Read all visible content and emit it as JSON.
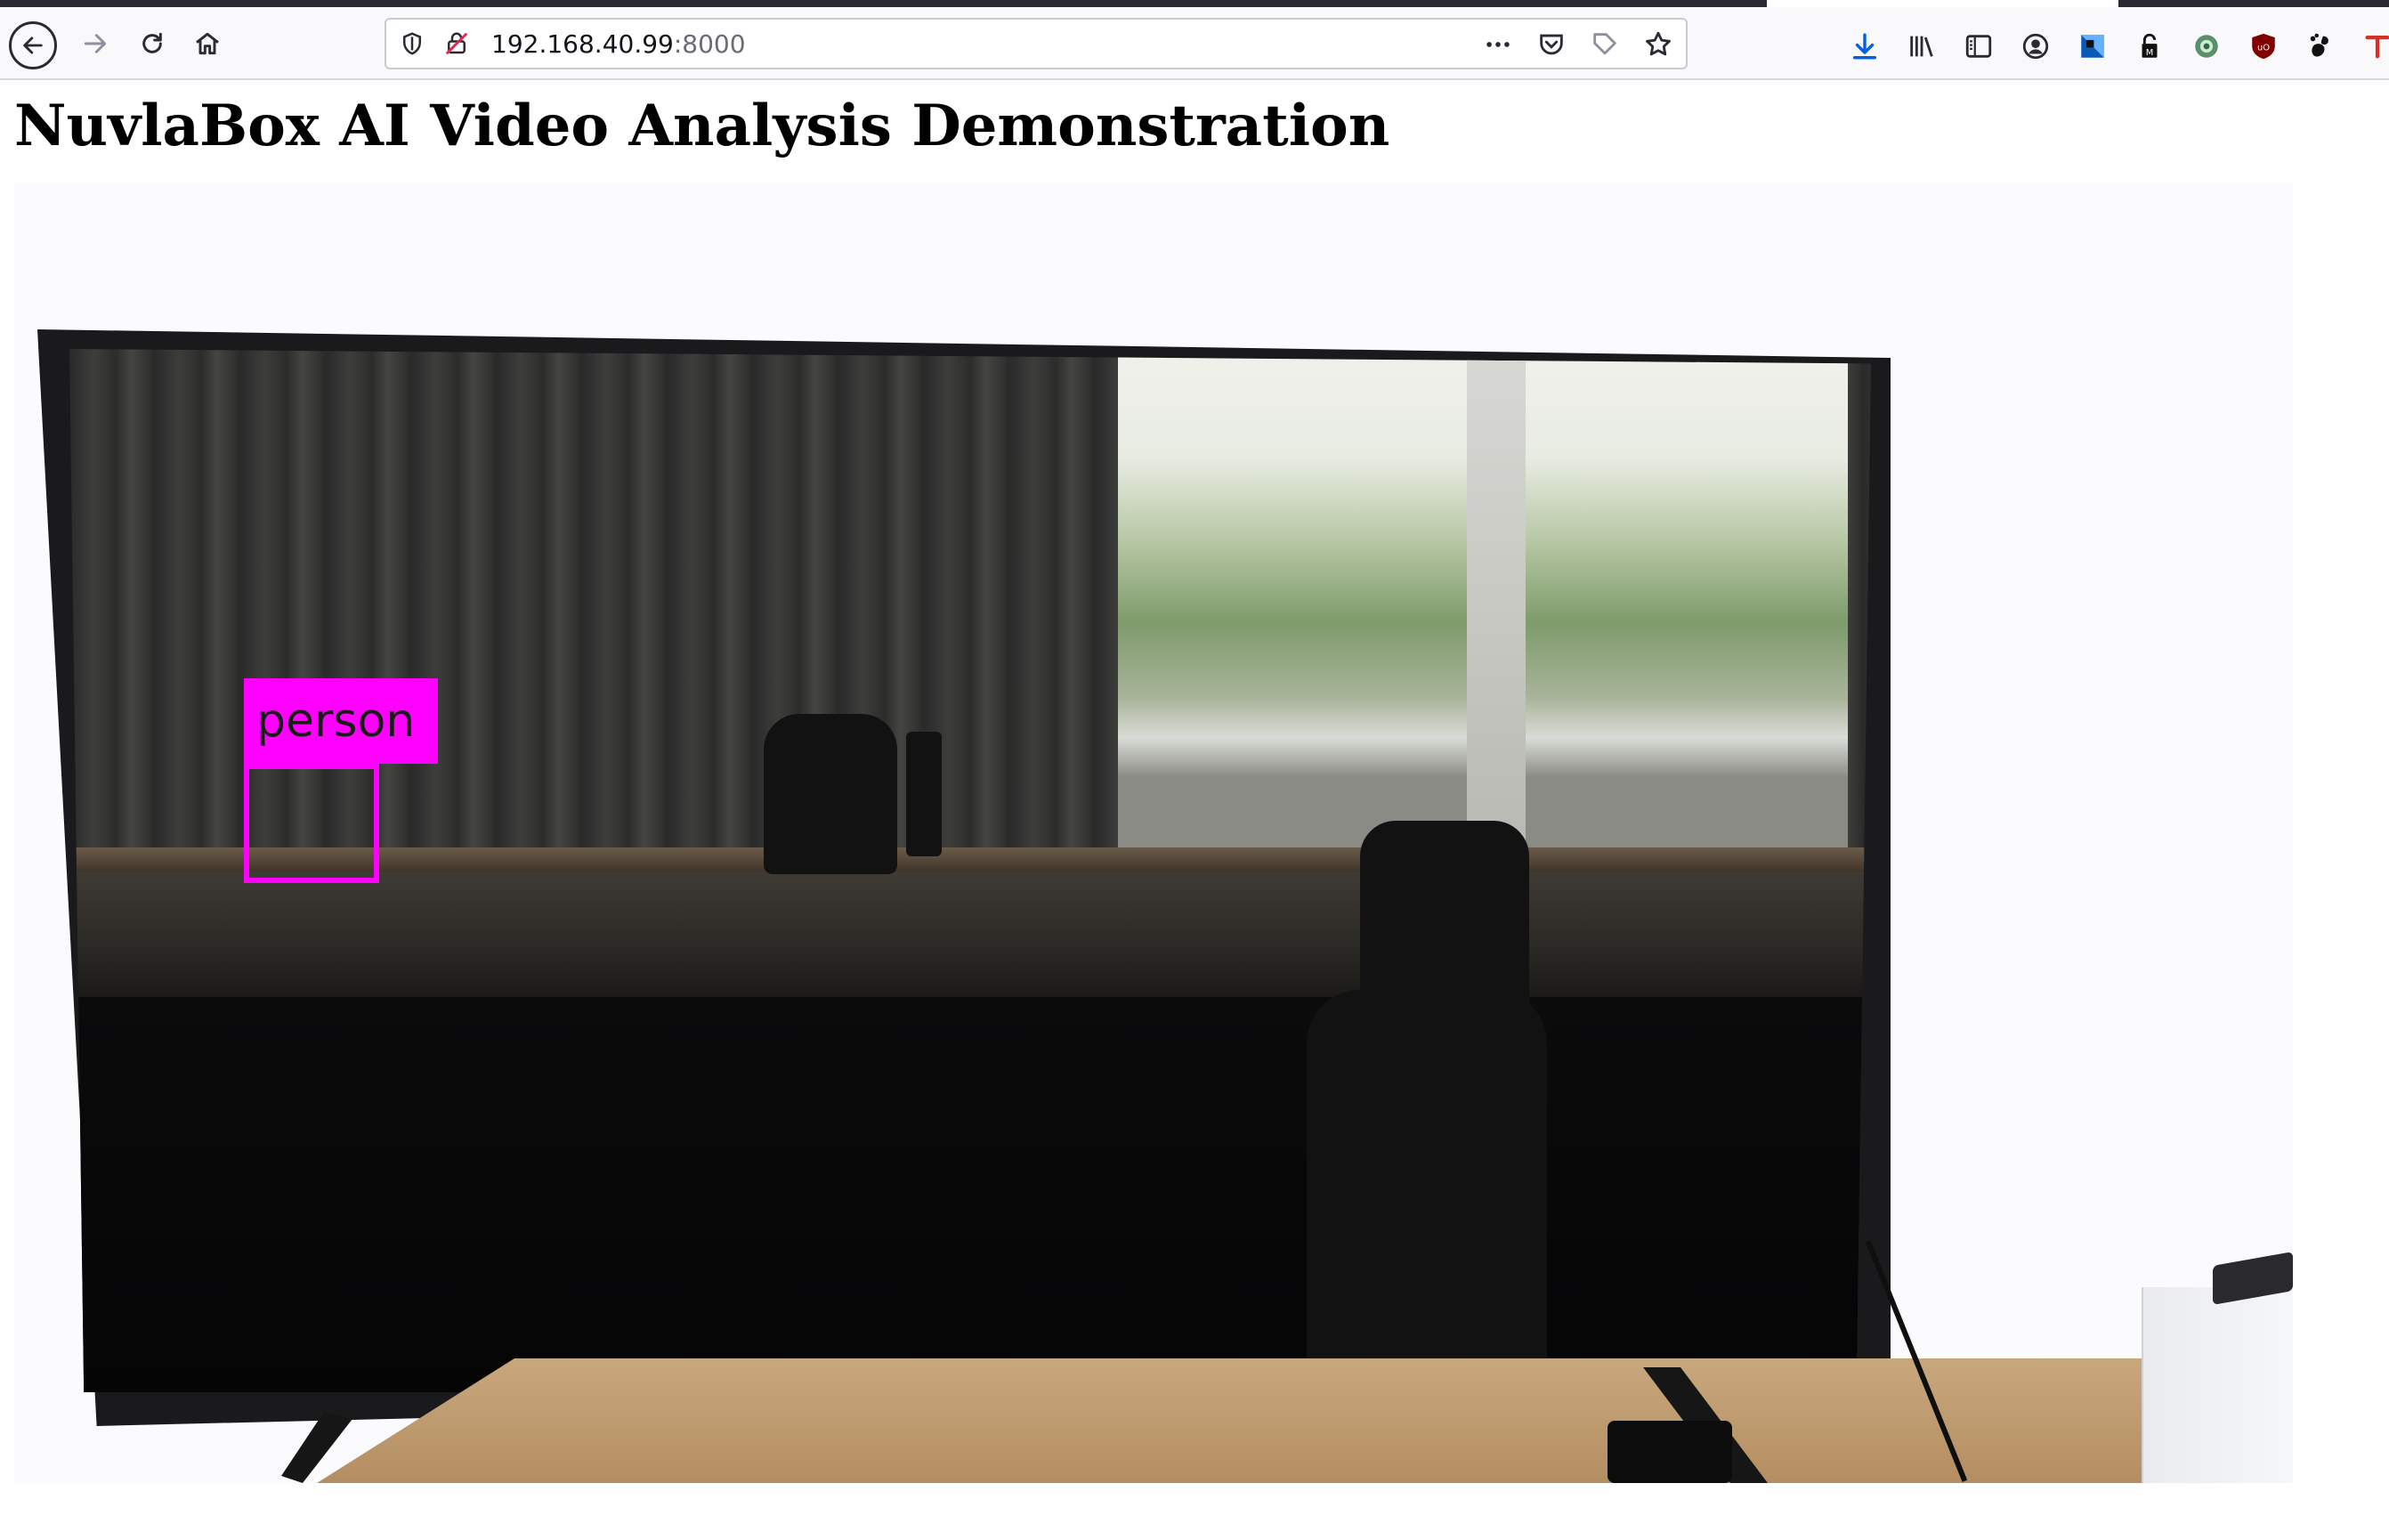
{
  "browser": {
    "url_host": "192.168.40.99",
    "url_port": ":8000",
    "colors": {
      "toolbar_bg": "#f9f9fb",
      "download_accent": "#0060df",
      "ublock_red": "#800000"
    },
    "nav_icons": [
      "back-arrow-icon",
      "forward-arrow-icon",
      "reload-icon",
      "home-icon"
    ],
    "url_icons": [
      "tracking-shield-icon",
      "insecure-lock-icon"
    ],
    "url_action_icons": [
      "more-actions-icon",
      "pocket-icon",
      "pin-tab-icon",
      "bookmark-star-icon"
    ],
    "extension_icons": [
      "download-icon",
      "library-icon",
      "reader-sidebar-icon",
      "account-icon",
      "extension-icon",
      "password-manager-icon",
      "vpn-icon",
      "ublock-icon",
      "gnome-icon",
      "translate-icon"
    ]
  },
  "page": {
    "title": "NuvlaBox AI Video Analysis Demonstration"
  },
  "video": {
    "detection_label": "person",
    "detection_color": "#ff00ff"
  }
}
